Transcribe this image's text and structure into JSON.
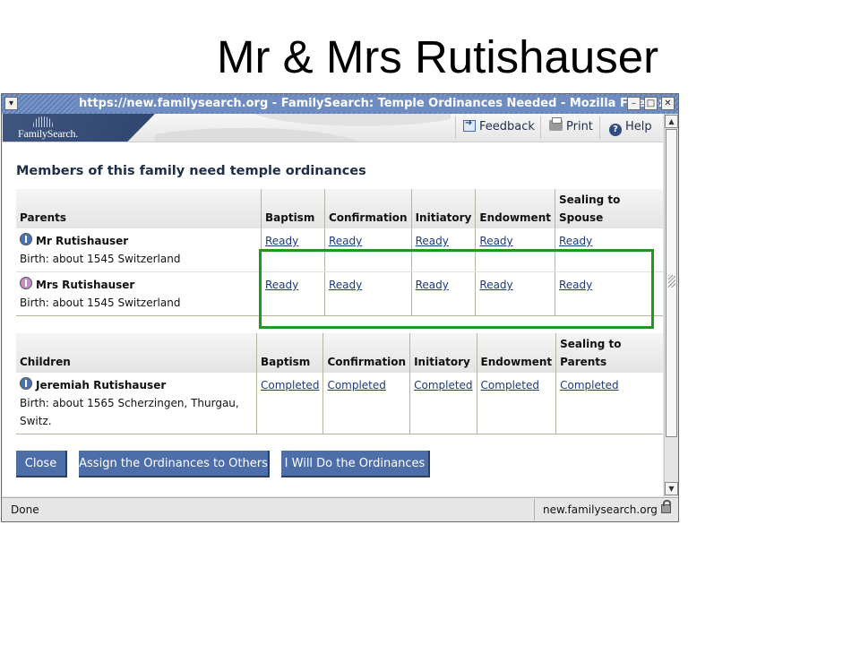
{
  "slide": {
    "title": "Mr & Mrs Rutishauser"
  },
  "window": {
    "title": "https://new.familysearch.org - FamilySearch: Temple Ordinances Needed - Mozilla Firefox",
    "menu_icon": "window-menu-icon",
    "controls": {
      "minimize": "minimize-icon",
      "maximize": "maximize-icon",
      "close": "close-icon"
    }
  },
  "header": {
    "logo_text": "FamilySearch.",
    "links": [
      {
        "label": "Feedback",
        "icon": "feedback-icon"
      },
      {
        "label": "Print",
        "icon": "printer-icon"
      },
      {
        "label": "Help",
        "icon": "help-icon"
      }
    ]
  },
  "main": {
    "heading": "Members of this family need temple ordinances",
    "parents_table": {
      "columns": [
        "Parents",
        "Baptism",
        "Confirmation",
        "Initiatory",
        "Endowment",
        "Sealing to Spouse"
      ],
      "rows": [
        {
          "name": "Mr Rutishauser",
          "gender": "male",
          "birth": "Birth: about 1545 Switzerland",
          "ordinances": [
            "Ready",
            "Ready",
            "Ready",
            "Ready",
            "Ready"
          ]
        },
        {
          "name": "Mrs Rutishauser",
          "gender": "female",
          "birth": "Birth: about 1545 Switzerland",
          "ordinances": [
            "Ready",
            "Ready",
            "Ready",
            "Ready",
            "Ready"
          ]
        }
      ]
    },
    "children_table": {
      "columns": [
        "Children",
        "Baptism",
        "Confirmation",
        "Initiatory",
        "Endowment",
        "Sealing to Parents"
      ],
      "rows": [
        {
          "name": "Jeremiah Rutishauser",
          "gender": "male",
          "birth": "Birth: about 1565 Scherzingen, Thurgau, Switz.",
          "ordinances": [
            "Completed",
            "Completed",
            "Completed",
            "Completed",
            "Completed"
          ]
        }
      ]
    },
    "buttons": {
      "close": "Close",
      "assign": "Assign the Ordinances to Others",
      "do": "I Will Do the Ordinances"
    },
    "highlight_color": "#1c9a1c"
  },
  "status_bar": {
    "text": "Done",
    "url": "new.familysearch.org",
    "lock_icon": "lock-icon"
  }
}
